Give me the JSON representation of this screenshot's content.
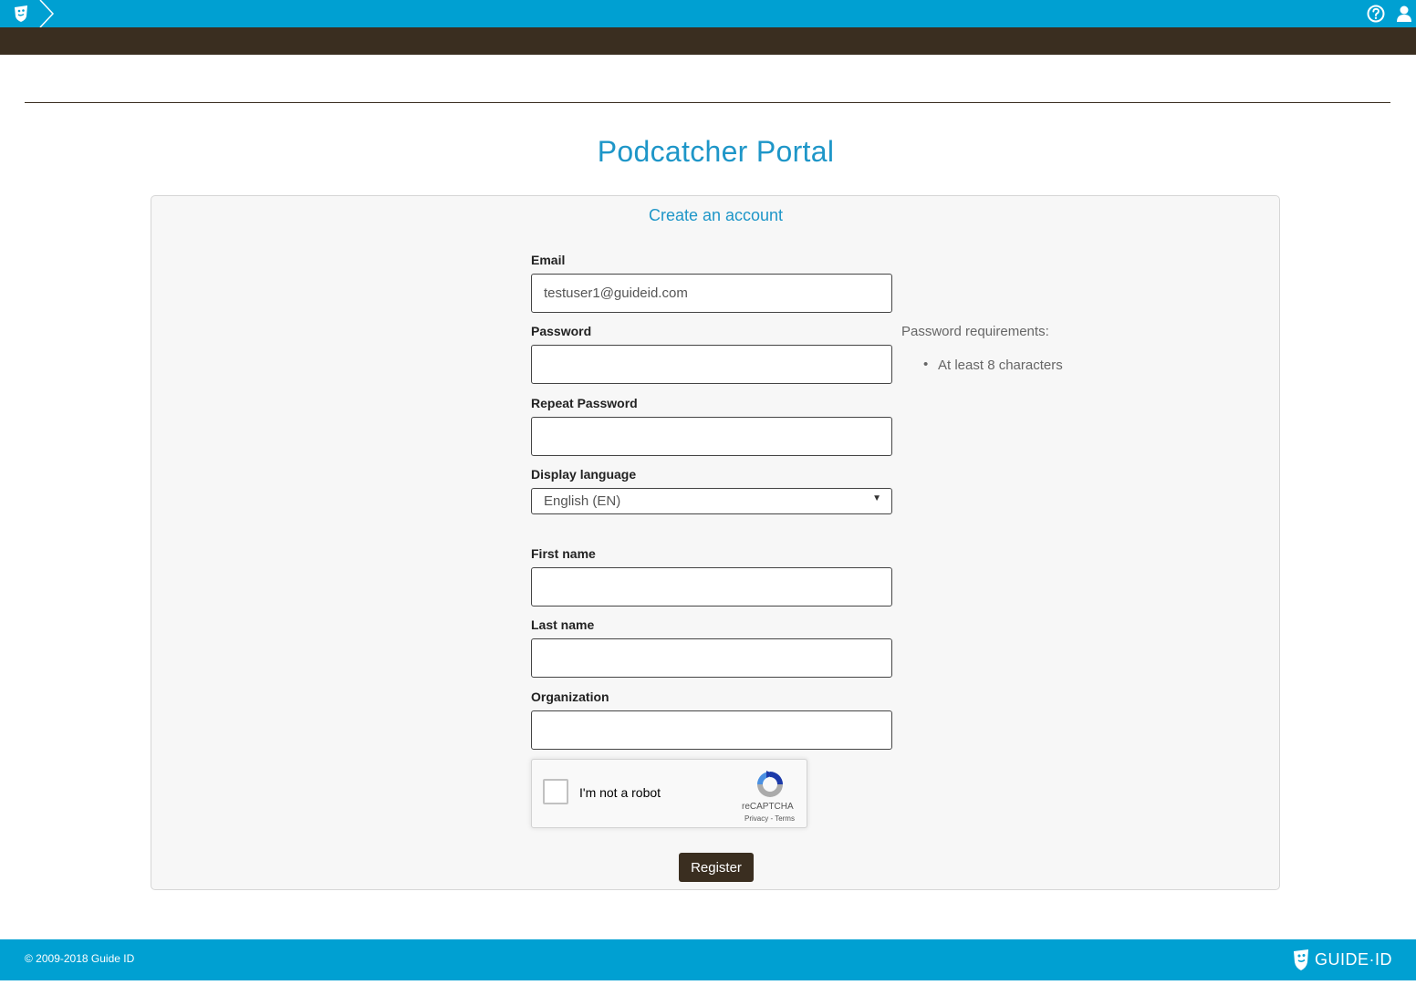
{
  "header": {
    "logo_icon": "guide-id-logo-icon",
    "breadcrumb_icon": "chevron-right-icon",
    "help_icon": "question-circle-icon",
    "user_icon": "user-icon"
  },
  "page": {
    "title": "Podcatcher Portal"
  },
  "form": {
    "title": "Create an account",
    "email": {
      "label": "Email",
      "value": "testuser1@guideid.com"
    },
    "password": {
      "label": "Password",
      "value": ""
    },
    "repeat_password": {
      "label": "Repeat Password",
      "value": ""
    },
    "display_language": {
      "label": "Display language",
      "selected": "English (EN)"
    },
    "first_name": {
      "label": "First name",
      "value": ""
    },
    "last_name": {
      "label": "Last name",
      "value": ""
    },
    "organization": {
      "label": "Organization",
      "value": ""
    },
    "password_requirements": {
      "title": "Password requirements:",
      "items": [
        "At least 8 characters"
      ]
    },
    "captcha": {
      "label": "I'm not a robot",
      "brand": "reCAPTCHA",
      "links": "Privacy - Terms"
    },
    "register_label": "Register"
  },
  "footer": {
    "copyright": "© 2009-2018 Guide ID",
    "brand": "GUIDE·ID"
  },
  "colors": {
    "primary": "#00a0d2",
    "dark": "#3a2e20",
    "title_blue": "#1e96c8"
  }
}
